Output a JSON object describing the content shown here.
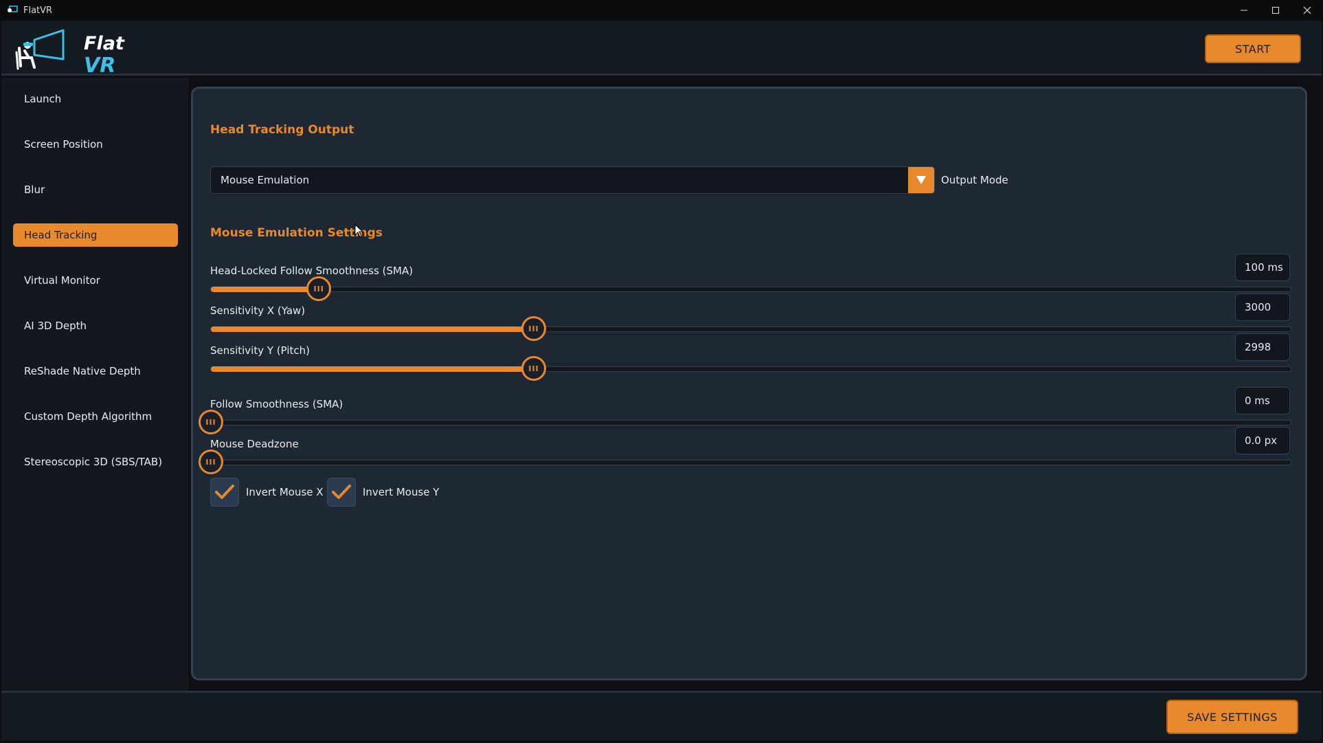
{
  "window": {
    "title": "FlatVR"
  },
  "header": {
    "logo_line1": "Flat",
    "logo_line2": "VR",
    "start_label": "START"
  },
  "sidebar": {
    "items": [
      {
        "label": "Launch",
        "active": false
      },
      {
        "label": "Screen Position",
        "active": false
      },
      {
        "label": "Blur",
        "active": false
      },
      {
        "label": "Head Tracking",
        "active": true
      },
      {
        "label": "Virtual Monitor",
        "active": false
      },
      {
        "label": "AI 3D Depth",
        "active": false
      },
      {
        "label": "ReShade Native Depth",
        "active": false
      },
      {
        "label": "Custom Depth Algorithm",
        "active": false
      },
      {
        "label": "Stereoscopic 3D (SBS/TAB)",
        "active": false
      }
    ]
  },
  "main": {
    "section1_title": "Head Tracking Output",
    "output_mode": {
      "value": "Mouse Emulation",
      "label": "Output Mode"
    },
    "section2_title": "Mouse Emulation Settings",
    "sliders": [
      {
        "label": "Head-Locked Follow Smoothness (SMA)",
        "value_text": "100 ms",
        "fraction": 0.1
      },
      {
        "label": "Sensitivity X (Yaw)",
        "value_text": "3000",
        "fraction": 0.299
      },
      {
        "label": "Sensitivity Y (Pitch)",
        "value_text": "2998",
        "fraction": 0.299
      },
      {
        "label": "Follow Smoothness (SMA)",
        "value_text": "0 ms",
        "fraction": 0.0
      },
      {
        "label": "Mouse Deadzone",
        "value_text": "0.0 px",
        "fraction": 0.0
      }
    ],
    "checkboxes": [
      {
        "label": "Invert Mouse X",
        "checked": true
      },
      {
        "label": "Invert Mouse Y",
        "checked": true
      }
    ]
  },
  "footer": {
    "save_label": "SAVE SETTINGS"
  },
  "colors": {
    "accent": "#e8892e",
    "logo_vr": "#3fbfe8",
    "panel": "#1e2833",
    "background": "#0d0f12"
  }
}
